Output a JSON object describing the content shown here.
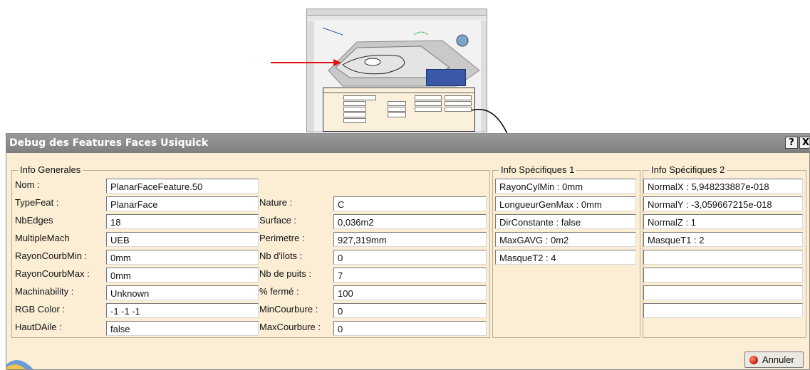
{
  "dialog": {
    "title": "Debug des Features Faces Usiquick",
    "help_label": "?",
    "close_label": "X",
    "cancel_label": "Annuler"
  },
  "info_generales": {
    "legend": "Info Generales",
    "nom_label": "Nom :",
    "nom_value": "PlanarFaceFeature.50",
    "left_rows": [
      {
        "label": "TypeFeat :",
        "value": "PlanarFace"
      },
      {
        "label": "NbEdges",
        "value": "18"
      },
      {
        "label": "MultipleMach",
        "value": "UEB"
      },
      {
        "label": "RayonCourbMin :",
        "value": "0mm"
      },
      {
        "label": "RayonCourbMax :",
        "value": "0mm"
      },
      {
        "label": "Machinability :",
        "value": "Unknown"
      },
      {
        "label": "RGB Color :",
        "value": "-1 -1 -1"
      },
      {
        "label": "HautDAile :",
        "value": "false"
      }
    ],
    "right_rows": [
      {
        "label": "Nature :",
        "value": "C"
      },
      {
        "label": "Surface :",
        "value": "0,036m2"
      },
      {
        "label": "Perimetre :",
        "value": "927,319mm"
      },
      {
        "label": "Nb d'ilots :",
        "value": "0"
      },
      {
        "label": "Nb de puits :",
        "value": "7"
      },
      {
        "label": "% fermé :",
        "value": "100"
      },
      {
        "label": "MinCourbure :",
        "value": "0"
      },
      {
        "label": "MaxCourbure :",
        "value": "0"
      }
    ]
  },
  "info_specifiques_1": {
    "legend": "Info Spécifiques 1",
    "values": [
      "RayonCylMin : 0mm",
      "LongueurGenMax : 0mm",
      "DirConstante : false",
      "MaxGAVG : 0m2",
      "MasqueT2 : 4"
    ]
  },
  "info_specifiques_2": {
    "legend": "Info Spécifiques 2",
    "values": [
      "NormalX : 5,948233887e-018",
      "NormalY : -3,059667215e-018",
      "NormalZ : 1",
      "MasqueT1 : 2",
      "",
      "",
      "",
      ""
    ]
  },
  "colors": {
    "dialog_bg": "#fbeed5",
    "titlebar": "#8a8a8a",
    "arrow_red": "#e01010",
    "cancel_icon": "#c21d0b"
  }
}
